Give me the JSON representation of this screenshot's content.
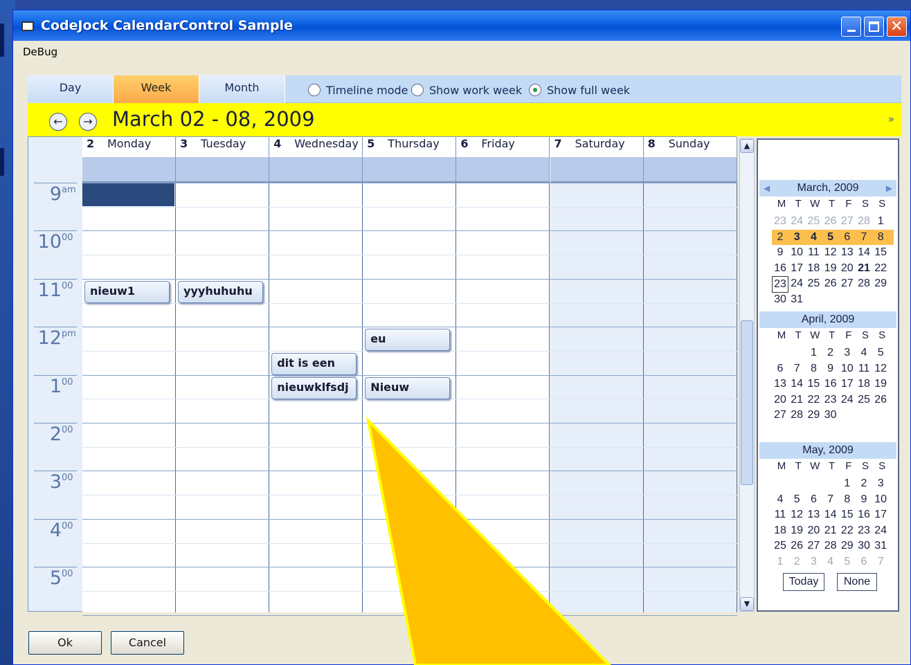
{
  "window": {
    "title": "CodeJock CalendarControl Sample"
  },
  "menu": {
    "debug_label": "DeBug"
  },
  "view_tabs": [
    {
      "label": "Day",
      "selected": false
    },
    {
      "label": "Week",
      "selected": true
    },
    {
      "label": "Month",
      "selected": false
    }
  ],
  "options": [
    {
      "label": "Timeline mode",
      "checked": false
    },
    {
      "label": "Show work week",
      "checked": false
    },
    {
      "label": "Show full week",
      "checked": true
    }
  ],
  "date_range": "March 02 - 08, 2009",
  "days": [
    {
      "num": "2",
      "name": "Monday",
      "weekend": false
    },
    {
      "num": "3",
      "name": "Tuesday",
      "weekend": false
    },
    {
      "num": "4",
      "name": "Wednesday",
      "weekend": false
    },
    {
      "num": "5",
      "name": "Thursday",
      "weekend": false
    },
    {
      "num": "6",
      "name": "Friday",
      "weekend": false
    },
    {
      "num": "7",
      "name": "Saturday",
      "weekend": true
    },
    {
      "num": "8",
      "name": "Sunday",
      "weekend": true
    }
  ],
  "hours": [
    {
      "h": "9",
      "sup": "am"
    },
    {
      "h": "10",
      "sup": "00"
    },
    {
      "h": "11",
      "sup": "00"
    },
    {
      "h": "12",
      "sup": "pm"
    },
    {
      "h": "1",
      "sup": "00"
    },
    {
      "h": "2",
      "sup": "00"
    },
    {
      "h": "3",
      "sup": "00"
    },
    {
      "h": "4",
      "sup": "00"
    },
    {
      "h": "5",
      "sup": "00"
    }
  ],
  "events": [
    {
      "title": "nieuw1",
      "day_index": 0,
      "start_hour": 11.0
    },
    {
      "title": "yyyhuhuhu",
      "day_index": 1,
      "start_hour": 11.0
    },
    {
      "title": "eu",
      "day_index": 3,
      "start_hour": 12.0
    },
    {
      "title": "dit is een",
      "day_index": 2,
      "start_hour": 12.5
    },
    {
      "title": "nieuwklfsdj",
      "day_index": 2,
      "start_hour": 13.0
    },
    {
      "title": "Nieuw",
      "day_index": 3,
      "start_hour": 13.0
    }
  ],
  "date_picker": {
    "dow": [
      "M",
      "T",
      "W",
      "T",
      "F",
      "S",
      "S"
    ],
    "months": [
      {
        "title": "March, 2009",
        "weeks": [
          [
            "23",
            "24",
            "25",
            "26",
            "27",
            "28",
            "1"
          ],
          [
            "2",
            "3",
            "4",
            "5",
            "6",
            "7",
            "8"
          ],
          [
            "9",
            "10",
            "11",
            "12",
            "13",
            "14",
            "15"
          ],
          [
            "16",
            "17",
            "18",
            "19",
            "20",
            "21",
            "22"
          ],
          [
            "23",
            "24",
            "25",
            "26",
            "27",
            "28",
            "29"
          ],
          [
            "30",
            "31",
            "",
            "",
            "",
            "",
            ""
          ]
        ]
      },
      {
        "title": "April, 2009",
        "weeks": [
          [
            "",
            "",
            "1",
            "2",
            "3",
            "4",
            "5"
          ],
          [
            "6",
            "7",
            "8",
            "9",
            "10",
            "11",
            "12"
          ],
          [
            "13",
            "14",
            "15",
            "16",
            "17",
            "18",
            "19"
          ],
          [
            "20",
            "21",
            "22",
            "23",
            "24",
            "25",
            "26"
          ],
          [
            "27",
            "28",
            "29",
            "30",
            "",
            "",
            ""
          ]
        ]
      },
      {
        "title": "May, 2009",
        "weeks": [
          [
            "",
            "",
            "",
            "",
            "1",
            "2",
            "3"
          ],
          [
            "4",
            "5",
            "6",
            "7",
            "8",
            "9",
            "10"
          ],
          [
            "11",
            "12",
            "13",
            "14",
            "15",
            "16",
            "17"
          ],
          [
            "18",
            "19",
            "20",
            "21",
            "22",
            "23",
            "24"
          ],
          [
            "25",
            "26",
            "27",
            "28",
            "29",
            "30",
            "31"
          ],
          [
            "1",
            "2",
            "3",
            "4",
            "5",
            "6",
            "7"
          ]
        ]
      }
    ],
    "today_label": "Today",
    "none_label": "None"
  },
  "buttons": {
    "ok_label": "Ok",
    "cancel_label": "Cancel"
  },
  "colors": {
    "accent_yellow": "#ffff00",
    "selected_tab": "#fca94a",
    "arrow_fill": "#ffc000",
    "selection_cell": "#2a4a7e"
  }
}
